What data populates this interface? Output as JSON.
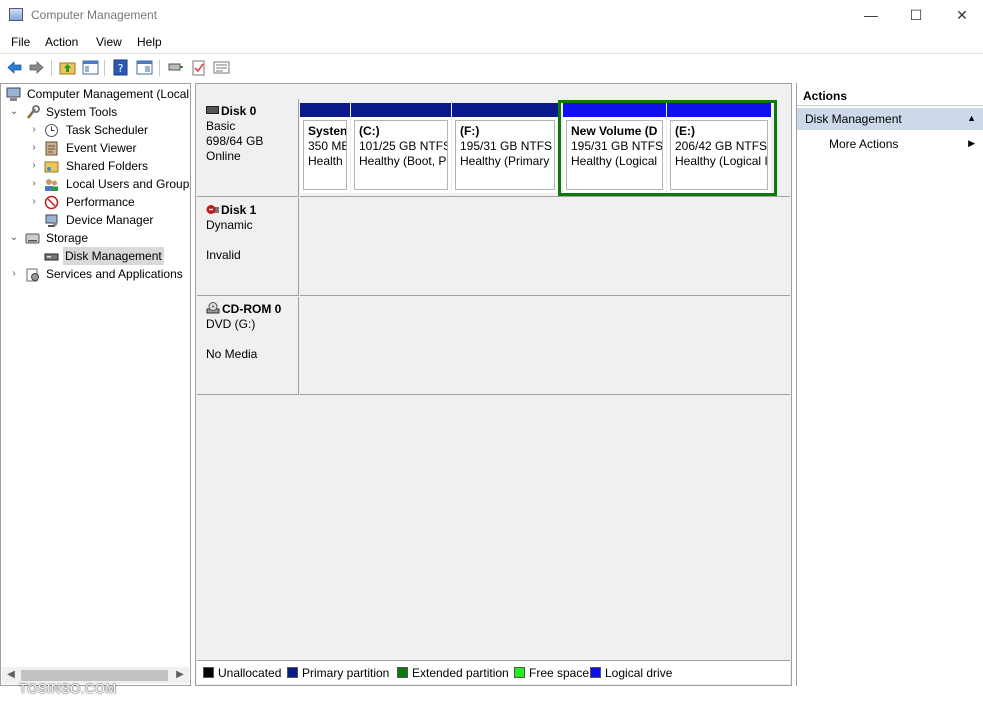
{
  "window": {
    "title": "Computer Management",
    "minimize": "—",
    "maximize": "☐",
    "close": "✕"
  },
  "menu": [
    "File",
    "Action",
    "View",
    "Help"
  ],
  "tree": [
    {
      "label": "Computer Management (Local",
      "icon": "computer-management-icon",
      "chevron": ""
    },
    {
      "label": "System Tools",
      "icon": "system-tools-icon",
      "chevron": "⌄"
    },
    {
      "label": "Task Scheduler",
      "icon": "task-scheduler-icon",
      "chevron": "›"
    },
    {
      "label": "Event Viewer",
      "icon": "event-viewer-icon",
      "chevron": "›"
    },
    {
      "label": "Shared Folders",
      "icon": "shared-folders-icon",
      "chevron": "›"
    },
    {
      "label": "Local Users and Groups",
      "icon": "local-users-icon",
      "chevron": "›"
    },
    {
      "label": "Performance",
      "icon": "performance-icon",
      "chevron": "›"
    },
    {
      "label": "Device Manager",
      "icon": "device-manager-icon",
      "chevron": ""
    },
    {
      "label": "Storage",
      "icon": "storage-icon",
      "chevron": "⌄"
    },
    {
      "label": "Disk Management",
      "icon": "disk-management-icon",
      "chevron": ""
    },
    {
      "label": "Services and Applications",
      "icon": "services-icon",
      "chevron": "›"
    }
  ],
  "disks": [
    {
      "name": "Disk 0",
      "line1": "Basic",
      "line2": "698/64 GB",
      "line3": "Online"
    },
    {
      "name": "Disk 1",
      "line1": "Dynamic",
      "line2": "",
      "line3": "Invalid"
    },
    {
      "name": "CD-ROM 0",
      "line1": "DVD (G:)",
      "line2": "",
      "line3": "No Media"
    }
  ],
  "partitions": [
    {
      "name": "Systen",
      "size": "350 MB",
      "status": "Health",
      "type": "primary"
    },
    {
      "name": "(C:)",
      "size": "101/25 GB NTFS",
      "status": "Healthy (Boot, P",
      "type": "primary"
    },
    {
      "name": "(F:)",
      "size": "195/31 GB NTFS",
      "status": "Healthy (Primary",
      "type": "primary"
    },
    {
      "name": "New Volume  (D",
      "size": "195/31 GB NTFS",
      "status": "Healthy (Logical",
      "type": "logical"
    },
    {
      "name": "(E:)",
      "size": "206/42 GB NTFS",
      "status": "Healthy (Logical I",
      "type": "logical"
    }
  ],
  "legend": [
    {
      "label": "Unallocated",
      "color": "#000000"
    },
    {
      "label": "Primary partition",
      "color": "#0a1a8a"
    },
    {
      "label": "Extended partition",
      "color": "#0b7a0b"
    },
    {
      "label": "Free space",
      "color": "#22ee22"
    },
    {
      "label": "Logical drive",
      "color": "#1010ee"
    }
  ],
  "actions": {
    "header": "Actions",
    "group": "Disk Management",
    "more": "More Actions"
  },
  "watermark": "TOSINSO.COM"
}
